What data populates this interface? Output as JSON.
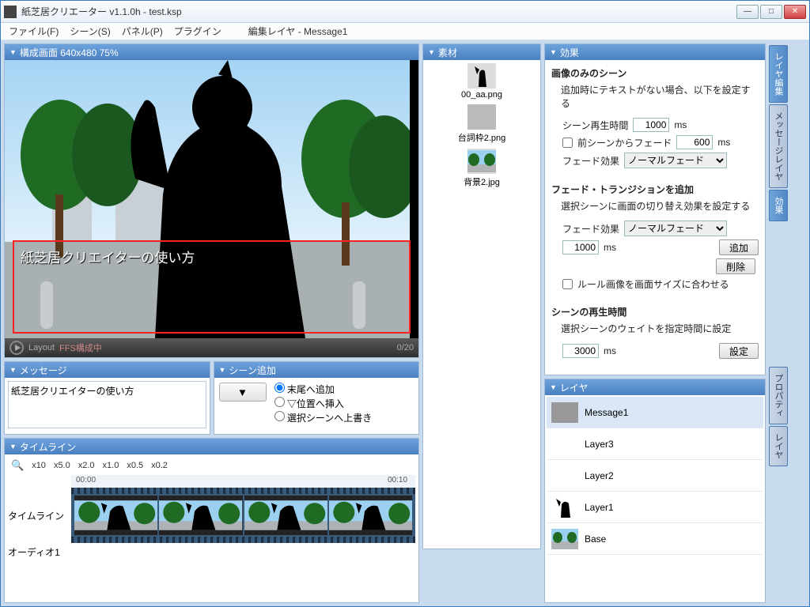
{
  "title": "紙芝居クリエーター v1.1.0h - test.ksp",
  "menu": {
    "file": "ファイル(F)",
    "scene": "シーン(S)",
    "panel": "パネル(P)",
    "plugin": "プラグイン",
    "editlayer": "編集レイヤ - Message1"
  },
  "composition": {
    "header": "構成画面 640x480 75%",
    "message_overlay": "紙芝居クリエイターの使い方",
    "play_label": "Layout",
    "status": "FFS構成中",
    "counter": "0/20"
  },
  "message_panel": {
    "header": "メッセージ",
    "text": "紙芝居クリエイターの使い方"
  },
  "scene_add": {
    "header": "シーン追加",
    "opt1": "末尾へ追加",
    "opt2": "▽位置へ挿入",
    "opt3": "選択シーンへ上書き"
  },
  "timeline": {
    "header": "タイムライン",
    "zooms": [
      "x10",
      "x5.0",
      "x2.0",
      "x1.0",
      "x0.5",
      "x0.2"
    ],
    "t0": "00:00",
    "t1": "00:10",
    "row_timeline": "タイムライン",
    "row_audio": "オーディオ1"
  },
  "assets": {
    "header": "素材",
    "items": [
      "00_aa.png",
      "台詞枠2.png",
      "背景2.jpg"
    ]
  },
  "effects": {
    "header": "効果",
    "sec1_title": "画像のみのシーン",
    "sec1_desc": "追加時にテキストがない場合、以下を設定する",
    "scene_play_label": "シーン再生時間",
    "scene_play_val": "1000",
    "ms": "ms",
    "prev_fade_label": "前シーンからフェード",
    "prev_fade_val": "600",
    "fade_effect_label": "フェード効果",
    "fade_effect_opt": "ノーマルフェード",
    "sec2_title": "フェード・トランジションを追加",
    "sec2_desc": "選択シーンに画面の切り替え効果を設定する",
    "trans_val": "1000",
    "btn_add": "追加",
    "btn_del": "削除",
    "rule_img_label": "ルール画像を画面サイズに合わせる",
    "sec3_title": "シーンの再生時間",
    "sec3_desc": "選択シーンのウェイトを指定時間に設定",
    "sec3_val": "3000",
    "btn_set": "設定"
  },
  "layers": {
    "header": "レイヤ",
    "items": [
      "Message1",
      "Layer3",
      "Layer2",
      "Layer1",
      "Base"
    ]
  },
  "sidetabs": [
    "レイヤ編集",
    "メッセージレイヤ",
    "効果",
    "プロパティ",
    "レイヤ"
  ]
}
